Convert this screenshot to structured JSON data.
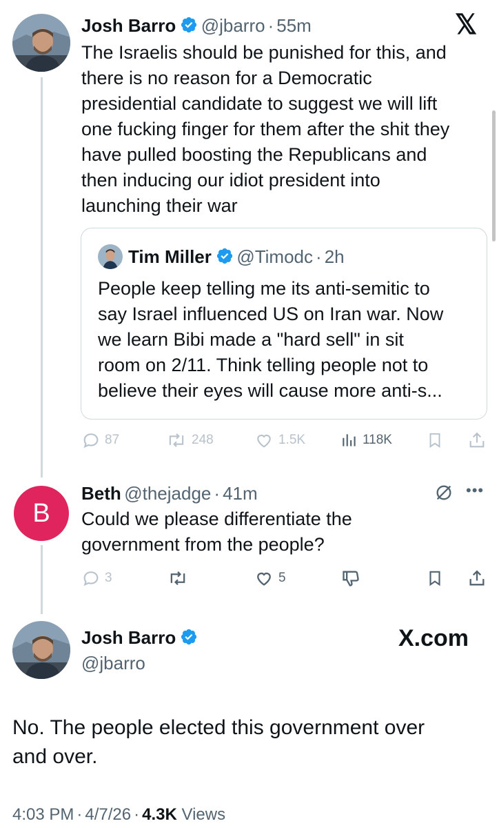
{
  "x_logo": "𝕏",
  "main_tweet": {
    "name": "Josh Barro",
    "handle": "@jbarro",
    "time": "55m",
    "text_lines": [
      "The Israelis should be punished for this, and",
      "there is no reason for a Democratic",
      "presidential candidate to suggest we will lift",
      "one fucking finger for them after the shit they",
      "have pulled boosting the Republicans and",
      "then inducing our idiot president into",
      "launching their war"
    ],
    "quote": {
      "name": "Tim Miller",
      "handle": "@Timodc",
      "time": "2h",
      "text_lines": [
        "People keep telling me its anti-semitic to",
        "say Israel influenced US on Iran war. Now",
        "we learn Bibi made a \"hard sell\" in sit",
        "room on 2/11. Think telling people not to",
        "believe their eyes will cause more anti-s..."
      ]
    },
    "actions": {
      "replies": "87",
      "reposts": "248",
      "likes": "1.5K",
      "views": "118K"
    }
  },
  "reply": {
    "avatar_letter": "B",
    "avatar_color": "#e0245e",
    "name": "Beth",
    "handle": "@thejadge",
    "time": "41m",
    "text_lines": [
      "Could we please differentiate the",
      "government from the people?"
    ],
    "actions": {
      "replies": "3",
      "likes": "5"
    }
  },
  "final_tweet": {
    "name": "Josh Barro",
    "handle": "@jbarro",
    "brand": "X.com",
    "text_lines": [
      "No. The people elected this government over",
      "and over."
    ],
    "time": "4:03 PM",
    "date": "4/7/26",
    "views_count": "4.3K",
    "views_label": "Views"
  },
  "colors": {
    "verified": "#1d9bf0",
    "muted": "#536471",
    "faded": "#b8c2cb",
    "border": "#cfd9de"
  }
}
